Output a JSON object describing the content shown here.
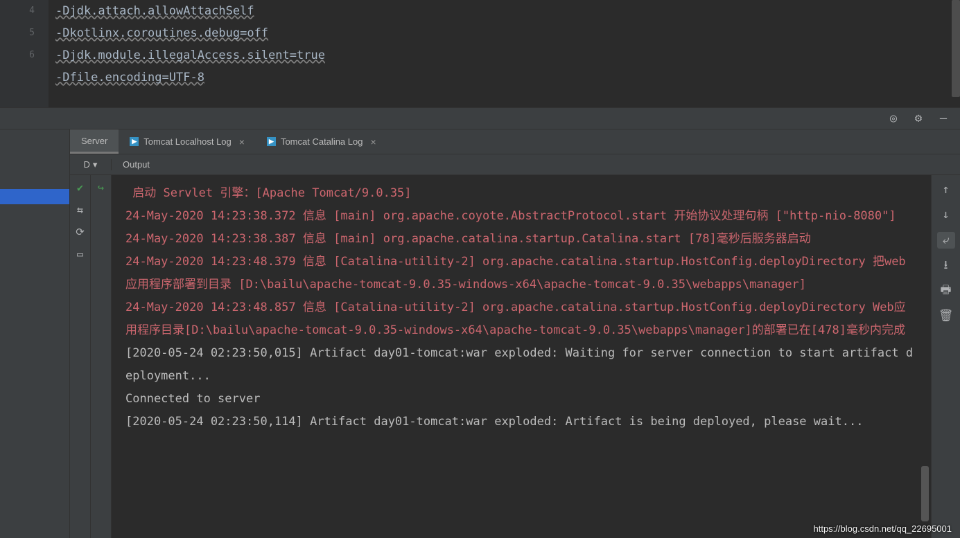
{
  "editor": {
    "lines": [
      {
        "num": "",
        "text": "-Djdk.attach.allowAttachSelf"
      },
      {
        "num": "4",
        "text": "-Dkotlinx.coroutines.debug=off"
      },
      {
        "num": "5",
        "text": "-Djdk.module.illegalAccess.silent=true"
      },
      {
        "num": "6",
        "text": "-Dfile.encoding=UTF-8"
      }
    ]
  },
  "tabs": {
    "server": "Server",
    "localhost": "Tomcat Localhost Log",
    "catalina": "Tomcat Catalina Log"
  },
  "subheader": {
    "left": "D",
    "right": "Output"
  },
  "log": [
    {
      "class": "red",
      "text": " 启动 Servlet 引擎：[Apache Tomcat/9.0.35]"
    },
    {
      "class": "red",
      "text": "24-May-2020 14:23:38.372 信息 [main] org.apache.coyote.AbstractProtocol.start 开始协议处理句柄 [\"http-nio-8080\"]"
    },
    {
      "class": "red",
      "text": "24-May-2020 14:23:38.387 信息 [main] org.apache.catalina.startup.Catalina.start [78]毫秒后服务器启动"
    },
    {
      "class": "red",
      "text": "24-May-2020 14:23:48.379 信息 [Catalina-utility-2] org.apache.catalina.startup.HostConfig.deployDirectory 把web 应用程序部署到目录 [D:\\bailu\\apache-tomcat-9.0.35-windows-x64\\apache-tomcat-9.0.35\\webapps\\manager]"
    },
    {
      "class": "red",
      "text": "24-May-2020 14:23:48.857 信息 [Catalina-utility-2] org.apache.catalina.startup.HostConfig.deployDirectory Web应用程序目录[D:\\bailu\\apache-tomcat-9.0.35-windows-x64\\apache-tomcat-9.0.35\\webapps\\manager]的部署已在[478]毫秒内完成"
    },
    {
      "class": "grey",
      "text": "[2020-05-24 02:23:50,015] Artifact day01-tomcat:war exploded: Waiting for server connection to start artifact deployment..."
    },
    {
      "class": "grey",
      "text": "Connected to server"
    },
    {
      "class": "grey",
      "text": "[2020-05-24 02:23:50,114] Artifact day01-tomcat:war exploded: Artifact is being deployed, please wait..."
    }
  ],
  "watermark": "https://blog.csdn.net/qq_22695001"
}
